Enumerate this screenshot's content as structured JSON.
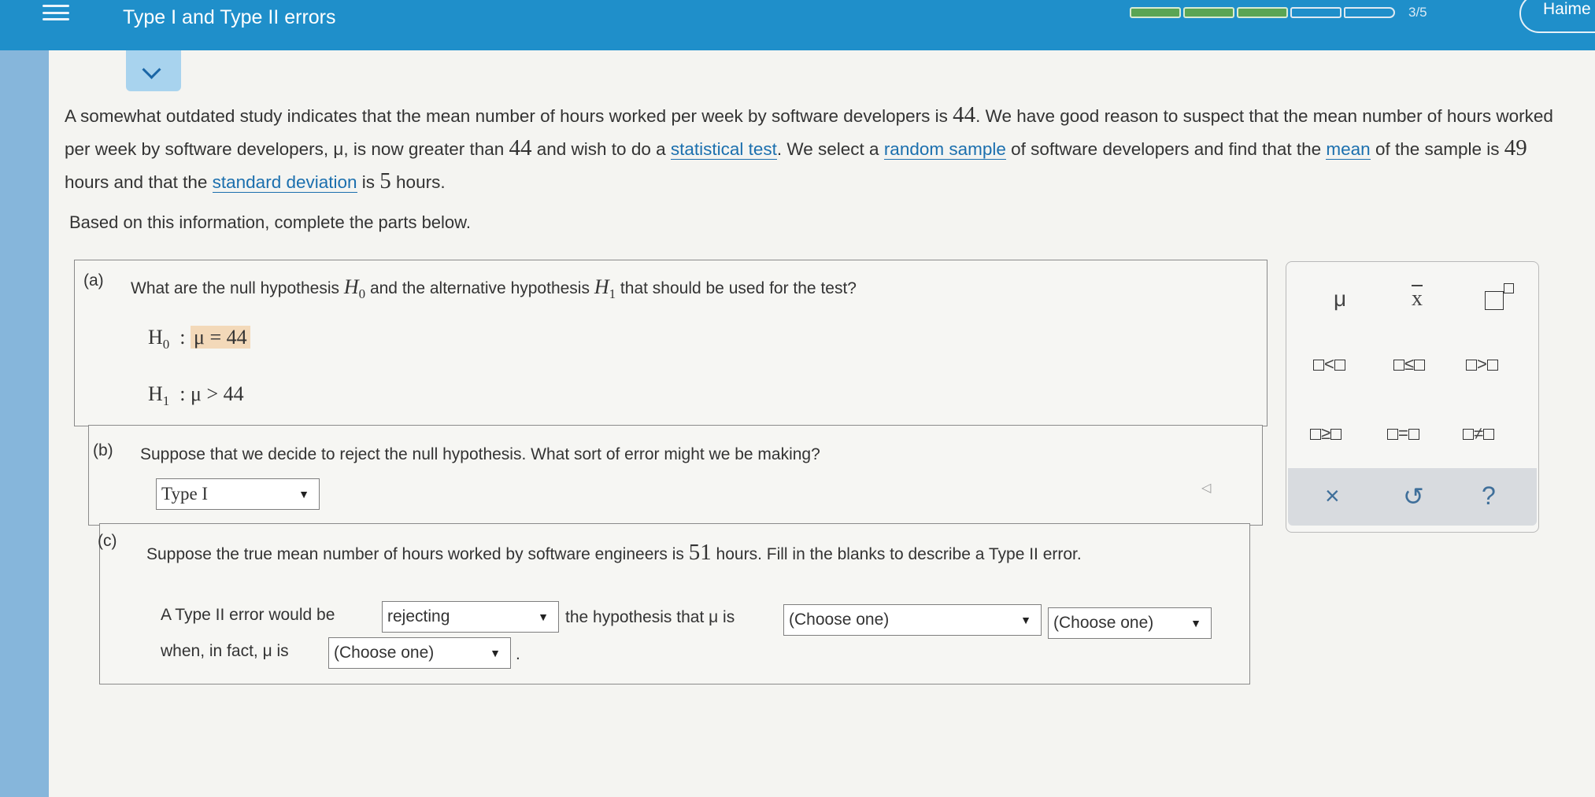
{
  "header": {
    "topic_title": "Type I and Type II errors",
    "progress": {
      "completed": 3,
      "total": 5,
      "text": "3/5"
    },
    "user_name": "Haime"
  },
  "problem": {
    "p1": "A somewhat outdated study indicates that the mean number of hours worked per week by software developers is ",
    "v1": "44",
    "p2": ". We have good reason to suspect that the mean number of hours worked per week by software developers, μ, is now greater than ",
    "v2": "44",
    "p3": " and wish to do a ",
    "link1": "statistical test",
    "p4": ". We select a ",
    "link2": "random sample",
    "p5": " of software developers and find that the ",
    "link3": "mean",
    "p6": " of the sample is ",
    "v3": "49",
    "p7": " hours and that the ",
    "link4": "standard deviation",
    "p8": " is ",
    "v4": "5",
    "p9": " hours.",
    "based_on": "Based on this information, complete the parts below."
  },
  "part_a": {
    "label": "(a)",
    "q1": "What are the null hypothesis ",
    "h0_sym": "H",
    "h0_sub": "0",
    "q2": " and the alternative hypothesis ",
    "h1_sym": "H",
    "h1_sub": "1",
    "q3": " that should be used for the test?",
    "null_answer": "μ = 44",
    "alt_answer": "μ > 44"
  },
  "part_b": {
    "label": "(b)",
    "question": "Suppose that we decide to reject the null hypothesis. What sort of error might we be making?",
    "answer": "Type I"
  },
  "part_c": {
    "label": "(c)",
    "q1": "Suppose the true mean number of hours worked by software engineers is ",
    "value": "51",
    "q2": " hours. Fill in the blanks to describe a Type II error.",
    "s1": "A Type II error would be",
    "dd1": "rejecting",
    "s2": "the hypothesis that μ is",
    "dd2": "(Choose one)",
    "dd3": "(Choose one)",
    "s3": "when, in fact, μ is",
    "dd4": "(Choose one)",
    "s4": "."
  },
  "palette": {
    "mu": "μ",
    "xbar": "x",
    "lt": "<",
    "le": "≤",
    "gt": ">",
    "ge": "≥",
    "eq": "=",
    "ne": "≠",
    "clear": "×",
    "undo": "↺",
    "help": "?"
  }
}
